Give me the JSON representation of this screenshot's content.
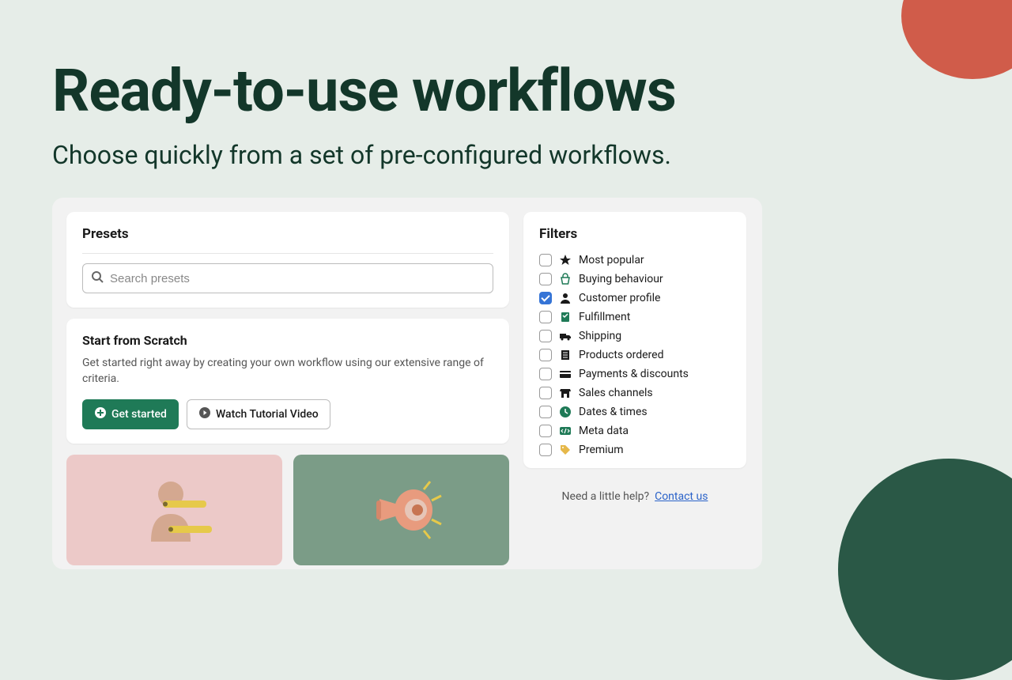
{
  "hero": {
    "title": "Ready-to-use workflows",
    "subtitle": "Choose quickly from a set of pre-configured workflows."
  },
  "presets": {
    "title": "Presets",
    "search_placeholder": "Search presets"
  },
  "scratch": {
    "title": "Start from Scratch",
    "description": "Get started right away by creating your own workflow using our extensive range of criteria.",
    "get_started_label": "Get started",
    "watch_video_label": "Watch Tutorial Video"
  },
  "filters": {
    "title": "Filters",
    "items": [
      {
        "label": "Most popular",
        "checked": false,
        "icon": "star"
      },
      {
        "label": "Buying behaviour",
        "checked": false,
        "icon": "basket"
      },
      {
        "label": "Customer profile",
        "checked": true,
        "icon": "person"
      },
      {
        "label": "Fulfillment",
        "checked": false,
        "icon": "clipboard"
      },
      {
        "label": "Shipping",
        "checked": false,
        "icon": "truck"
      },
      {
        "label": "Products ordered",
        "checked": false,
        "icon": "receipt"
      },
      {
        "label": "Payments & discounts",
        "checked": false,
        "icon": "card"
      },
      {
        "label": "Sales channels",
        "checked": false,
        "icon": "store"
      },
      {
        "label": "Dates & times",
        "checked": false,
        "icon": "clock"
      },
      {
        "label": "Meta data",
        "checked": false,
        "icon": "code"
      },
      {
        "label": "Premium",
        "checked": false,
        "icon": "tag"
      }
    ]
  },
  "help": {
    "text": "Need a little help?",
    "link": "Contact us"
  }
}
